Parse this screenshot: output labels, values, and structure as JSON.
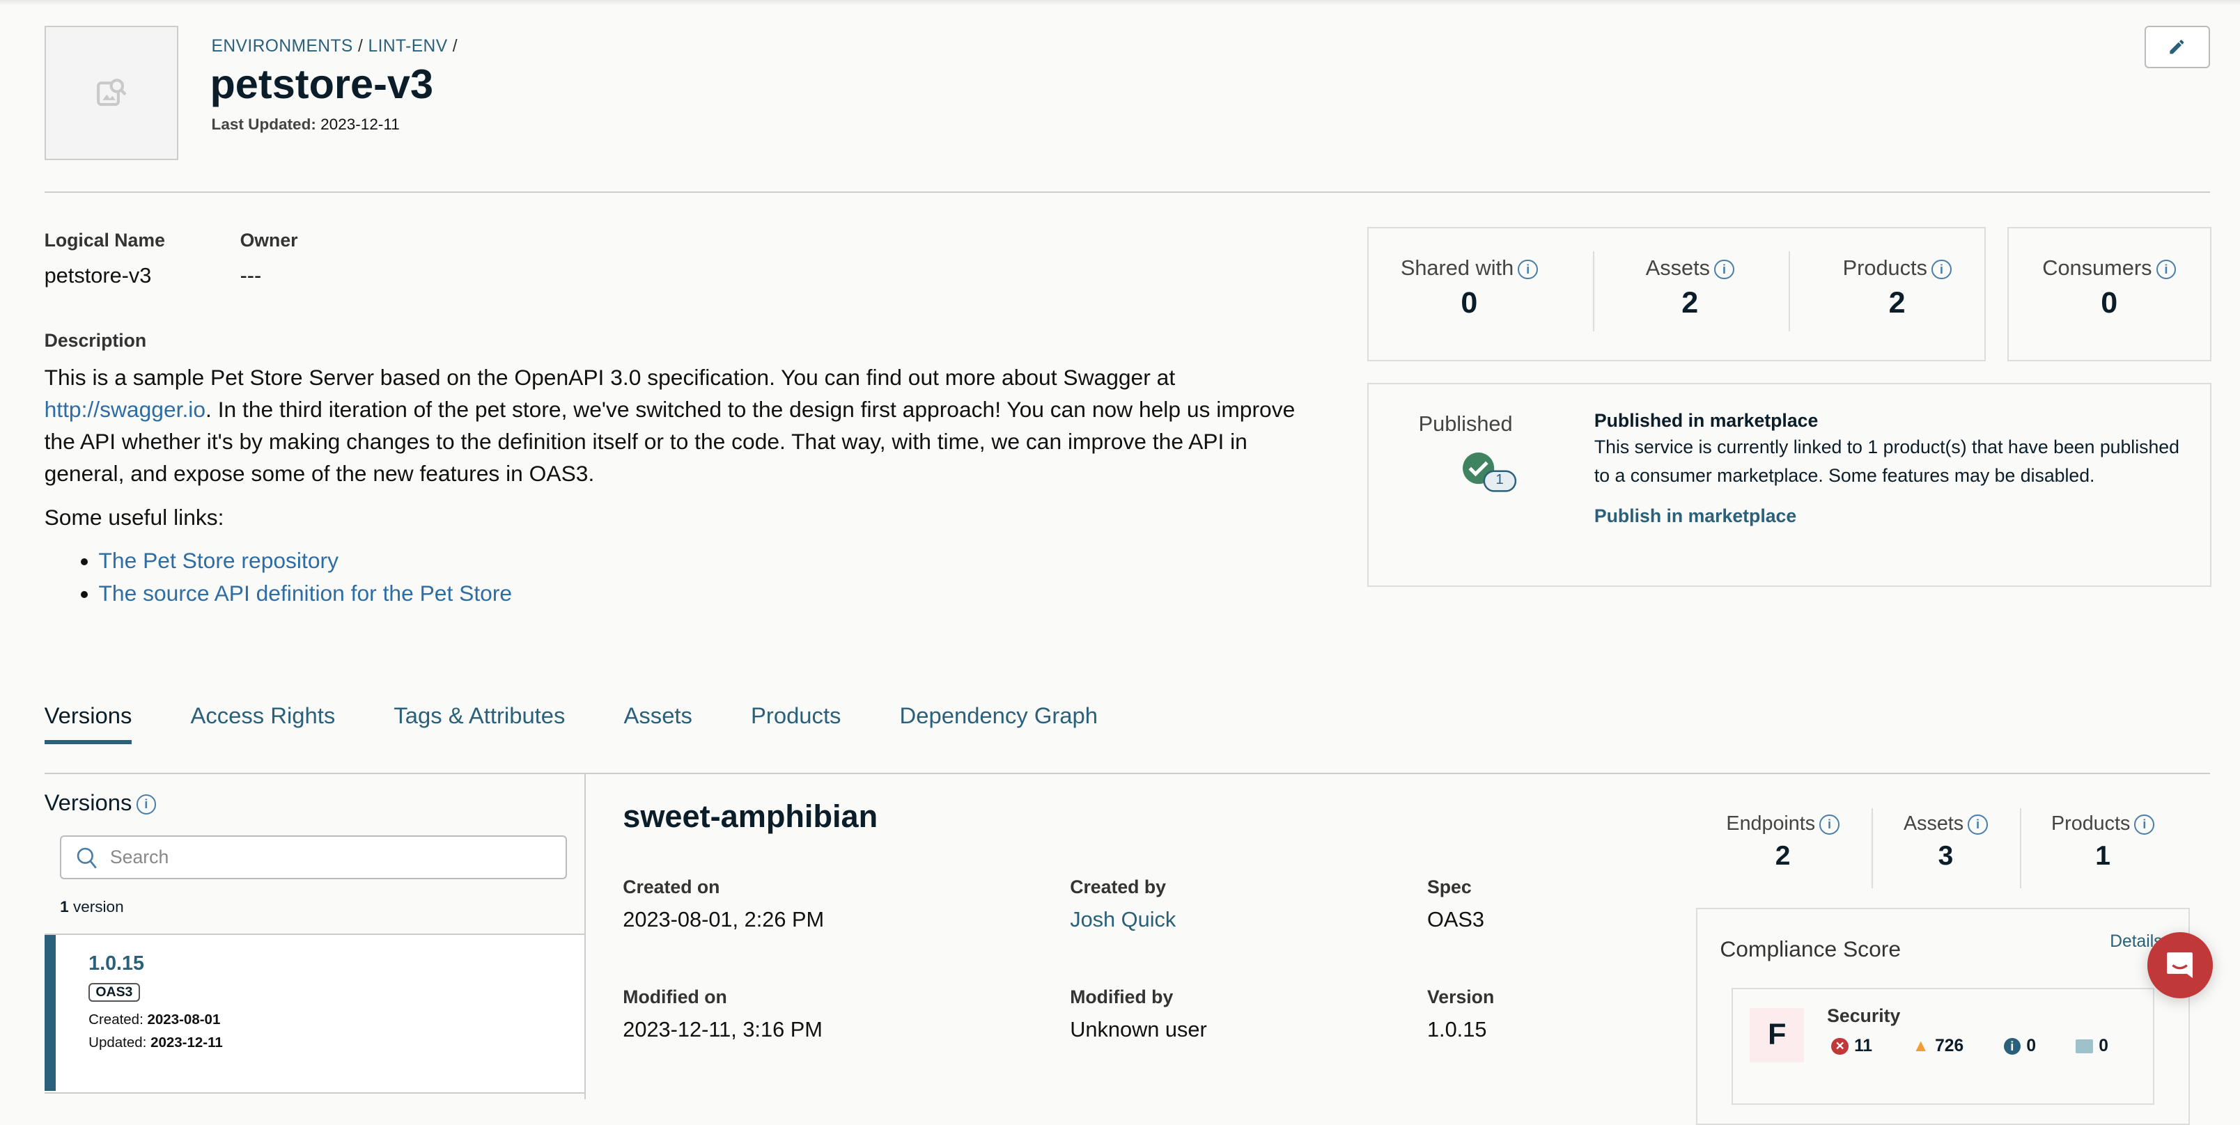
{
  "breadcrumb": {
    "items": [
      "ENVIRONMENTS",
      "LINT-ENV"
    ],
    "separator": "/"
  },
  "header": {
    "title": "petstore-v3",
    "last_updated_label": "Last Updated:",
    "last_updated": "2023-12-11",
    "edit_icon": "pencil-icon",
    "thumbnail_icon": "image-search-icon"
  },
  "overview": {
    "logical_name_label": "Logical Name",
    "logical_name": "petstore-v3",
    "owner_label": "Owner",
    "owner": "---",
    "description_label": "Description",
    "description_pre": "This is a sample Pet Store Server based on the OpenAPI 3.0 specification. You can find out more about Swagger at ",
    "description_link": "http://swagger.io",
    "description_post": ". In the third iteration of the pet store, we've switched to the design first approach! You can now help us improve the API whether it's by making changes to the definition itself or to the code. That way, with time, we can improve the API in general, and expose some of the new features in OAS3.",
    "useful_links_label": "Some useful links:",
    "links": [
      "The Pet Store repository",
      "The source API definition for the Pet Store"
    ]
  },
  "stats": [
    {
      "label": "Shared with",
      "value": "0"
    },
    {
      "label": "Assets",
      "value": "2"
    },
    {
      "label": "Products",
      "value": "2"
    },
    {
      "label": "Consumers",
      "value": "0"
    }
  ],
  "publish": {
    "status_label": "Published",
    "badge_count": "1",
    "title": "Published in marketplace",
    "text": "This service is currently linked to 1 product(s) that have been published to a consumer marketplace. Some features may be disabled.",
    "action": "Publish in marketplace",
    "color": "#3f8361"
  },
  "tabs": [
    {
      "label": "Versions",
      "active": true
    },
    {
      "label": "Access Rights"
    },
    {
      "label": "Tags & Attributes"
    },
    {
      "label": "Assets"
    },
    {
      "label": "Products"
    },
    {
      "label": "Dependency Graph"
    }
  ],
  "versions": {
    "title": "Versions",
    "search_placeholder": "Search",
    "count": "1",
    "count_label": "version",
    "items": [
      {
        "version": "1.0.15",
        "spec": "OAS3",
        "created_label": "Created:",
        "created": "2023-08-01",
        "updated_label": "Updated:",
        "updated": "2023-12-11"
      }
    ]
  },
  "version_detail": {
    "name": "sweet-amphibian",
    "fields": [
      {
        "label": "Created on",
        "value": "2023-08-01, 2:26 PM"
      },
      {
        "label": "Created by",
        "value": "Josh Quick"
      },
      {
        "label": "Spec",
        "value": "OAS3"
      },
      {
        "label": "Modified on",
        "value": "2023-12-11, 3:16 PM"
      },
      {
        "label": "Modified by",
        "value": "Unknown user"
      },
      {
        "label": "Version",
        "value": "1.0.15"
      }
    ],
    "stats": [
      {
        "label": "Endpoints",
        "value": "2"
      },
      {
        "label": "Assets",
        "value": "3"
      },
      {
        "label": "Products",
        "value": "1"
      }
    ]
  },
  "compliance": {
    "title": "Compliance Score",
    "details_link": "Details",
    "grade": "F",
    "category": "Security",
    "errors": "11",
    "warnings": "726",
    "info": "0",
    "hints": "0"
  },
  "colors": {
    "accent": "#2a6079",
    "link": "#2e6ca4",
    "error": "#c13838",
    "warning": "#f0a030"
  }
}
